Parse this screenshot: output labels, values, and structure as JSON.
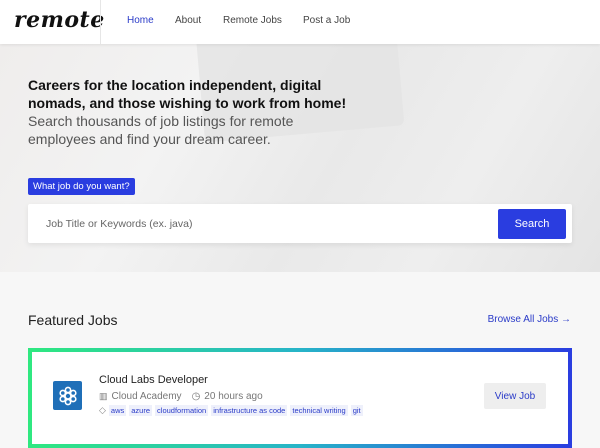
{
  "header": {
    "logo": "remote",
    "nav": [
      {
        "label": "Home",
        "active": true
      },
      {
        "label": "About"
      },
      {
        "label": "Remote Jobs"
      },
      {
        "label": "Post a Job"
      }
    ]
  },
  "hero": {
    "headline": "Careers for the location independent, digital nomads, and those wishing to work from home!",
    "subtitle": "Search thousands of job listings for remote employees and find your dream career.",
    "badge": "What job do you want?",
    "search_placeholder": "Job Title or Keywords (ex. java)",
    "search_button": "Search"
  },
  "featured": {
    "title": "Featured Jobs",
    "browse_label": "Browse All Jobs →",
    "jobs": [
      {
        "title": "Cloud Labs Developer",
        "company": "Cloud Academy",
        "posted": "20 hours ago",
        "tags": [
          "aws",
          "azure",
          "cloudformation",
          "infrastructure as code",
          "technical writing",
          "git"
        ],
        "button": "View Job"
      }
    ]
  },
  "colors": {
    "accent": "#2a3de0",
    "gradient_start": "#2fe880",
    "gradient_end": "#2a3de0"
  }
}
